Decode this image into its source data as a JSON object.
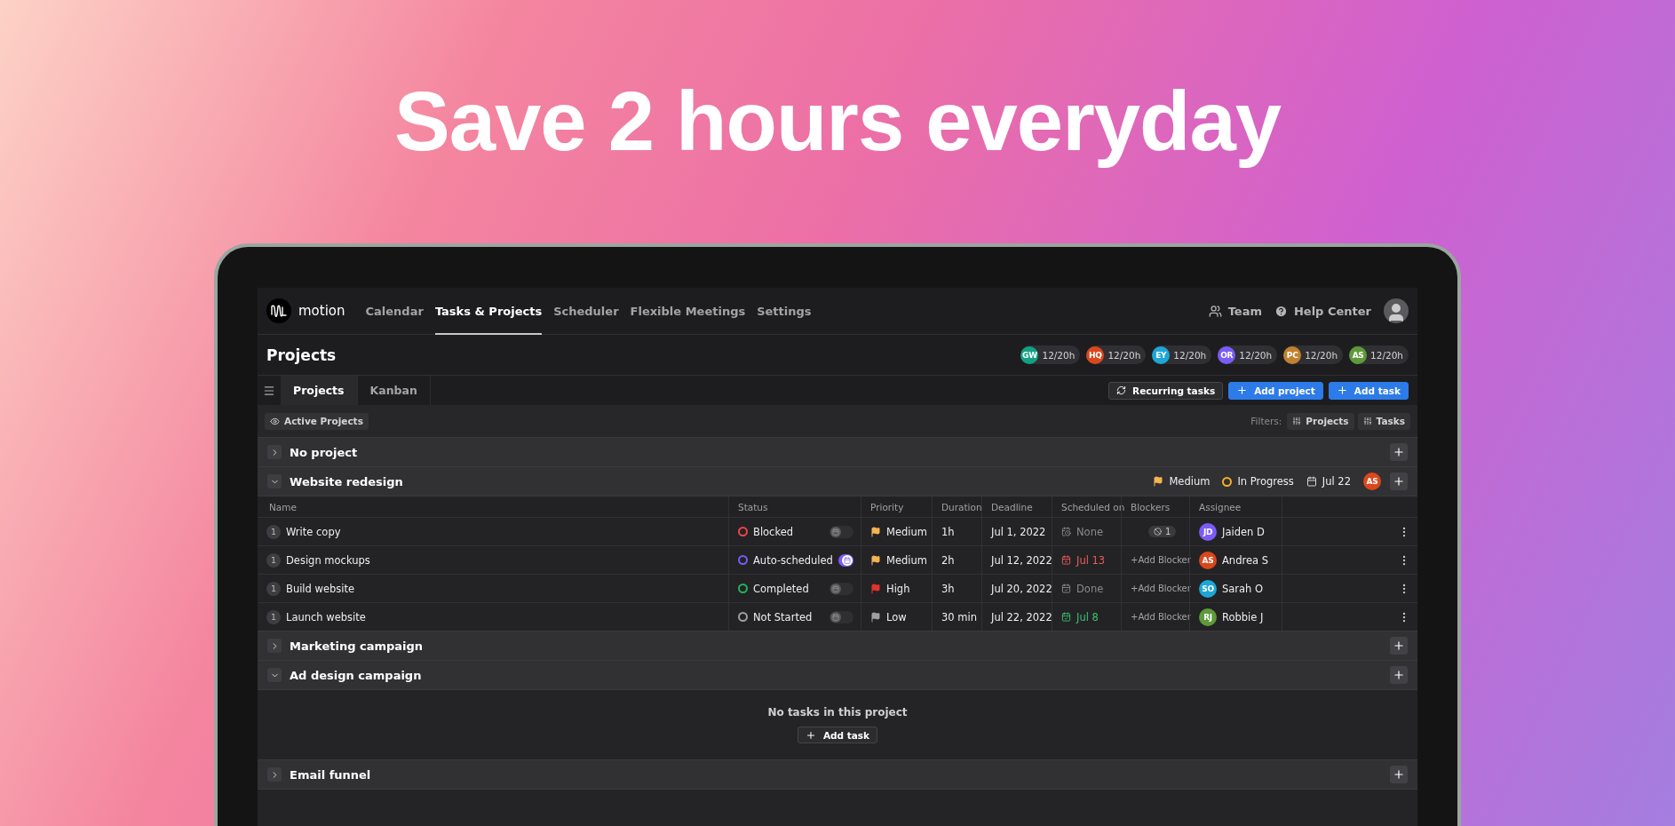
{
  "headline": "Save 2 hours everyday",
  "nav": {
    "brand": "motion",
    "items": [
      {
        "label": "Calendar",
        "selected": false
      },
      {
        "label": "Tasks & Projects",
        "selected": true
      },
      {
        "label": "Scheduler",
        "selected": false
      },
      {
        "label": "Flexible Meetings",
        "selected": false
      },
      {
        "label": "Settings",
        "selected": false
      }
    ],
    "links": [
      {
        "kind": "team",
        "label": "Team"
      },
      {
        "kind": "help",
        "label": "Help Center"
      }
    ]
  },
  "page_title": "Projects",
  "team_hours": [
    {
      "initials": "GW",
      "color": "#14a085",
      "hours": "12/20h"
    },
    {
      "initials": "HQ",
      "color": "#d9481c",
      "hours": "12/20h"
    },
    {
      "initials": "EY",
      "color": "#1da6d6",
      "hours": "12/20h"
    },
    {
      "initials": "OR",
      "color": "#7b5cf5",
      "hours": "12/20h"
    },
    {
      "initials": "PC",
      "color": "#c2812e",
      "hours": "12/20h"
    },
    {
      "initials": "AS",
      "color": "#5f9a3a",
      "hours": "12/20h"
    }
  ],
  "view_tabs": [
    {
      "label": "Projects",
      "selected": true
    },
    {
      "label": "Kanban",
      "selected": false
    }
  ],
  "actions": [
    {
      "kind": "secondary",
      "label": "Recurring tasks"
    },
    {
      "kind": "primary",
      "label": "Add project"
    },
    {
      "kind": "primary",
      "label": "Add task"
    }
  ],
  "active_filter": "Active Projects",
  "filters": {
    "label": "Filters:",
    "buttons": [
      "Projects",
      "Tasks"
    ]
  },
  "columns": [
    "Name",
    "Status",
    "Priority",
    "Duration",
    "Deadline",
    "Scheduled on",
    "Blockers",
    "Assignee"
  ],
  "projects": [
    {
      "name": "No project",
      "expanded": false
    },
    {
      "name": "Website redesign",
      "expanded": true,
      "meta": {
        "priority": {
          "text": "Medium",
          "color": "#f5b351"
        },
        "status": {
          "text": "In Progress",
          "color": "#f5b020"
        },
        "date": "Jul 22",
        "assignee": {
          "initials": "AS",
          "color": "#d9481c"
        }
      },
      "tasks": [
        {
          "count": "1",
          "name": "Write copy",
          "status": {
            "text": "Blocked",
            "color": "#ef4444"
          },
          "auto": false,
          "priority": {
            "text": "Medium",
            "color": "#f5b351"
          },
          "duration": "1h",
          "deadline": "Jul 1, 2022",
          "scheduled": {
            "kind": "unknown",
            "text": "None",
            "color": "#8a8a8e"
          },
          "blockers": {
            "kind": "count",
            "text": "1"
          },
          "assignee": {
            "initials": "JD",
            "name": "Jaiden D",
            "color": "#7b5cf5"
          }
        },
        {
          "count": "1",
          "name": "Design mockups",
          "status": {
            "text": "Auto-scheduled",
            "color": "#7b5cf5"
          },
          "auto": true,
          "priority": {
            "text": "Medium",
            "color": "#f5b351"
          },
          "duration": "2h",
          "deadline": "Jul 12, 2022",
          "scheduled": {
            "kind": "missed",
            "text": "Jul 13",
            "color": "#ee5a5a"
          },
          "blockers": {
            "kind": "add",
            "text": "+Add Blocker"
          },
          "assignee": {
            "initials": "AS",
            "name": "Andrea S",
            "color": "#d9481c"
          }
        },
        {
          "count": "1",
          "name": "Build website",
          "status": {
            "text": "Completed",
            "color": "#22b45a"
          },
          "auto": false,
          "priority": {
            "text": "High",
            "color": "#e5322d"
          },
          "duration": "3h",
          "deadline": "Jul 20, 2022",
          "scheduled": {
            "kind": "done",
            "text": "Done",
            "color": "#8a8a8e"
          },
          "blockers": {
            "kind": "add",
            "text": "+Add Blocker"
          },
          "assignee": {
            "initials": "SO",
            "name": "Sarah O",
            "color": "#1da6d6"
          }
        },
        {
          "count": "1",
          "name": "Launch website",
          "status": {
            "text": "Not Started",
            "color": "#a0a0a4"
          },
          "auto": false,
          "priority": {
            "text": "Low",
            "color": "#a0a0a4"
          },
          "duration": "30 min",
          "deadline": "Jul 22, 2022",
          "scheduled": {
            "kind": "scheduled",
            "text": "Jul 8",
            "color": "#3cc070"
          },
          "blockers": {
            "kind": "add",
            "text": "+Add Blocker"
          },
          "assignee": {
            "initials": "RJ",
            "name": "Robbie J",
            "color": "#5f9a3a"
          }
        }
      ]
    },
    {
      "name": "Marketing campaign",
      "expanded": false
    },
    {
      "name": "Ad design campaign",
      "expanded": true,
      "empty_text": "No tasks in this project",
      "empty_action": "Add task"
    },
    {
      "name": "Email funnel",
      "expanded": false
    }
  ]
}
